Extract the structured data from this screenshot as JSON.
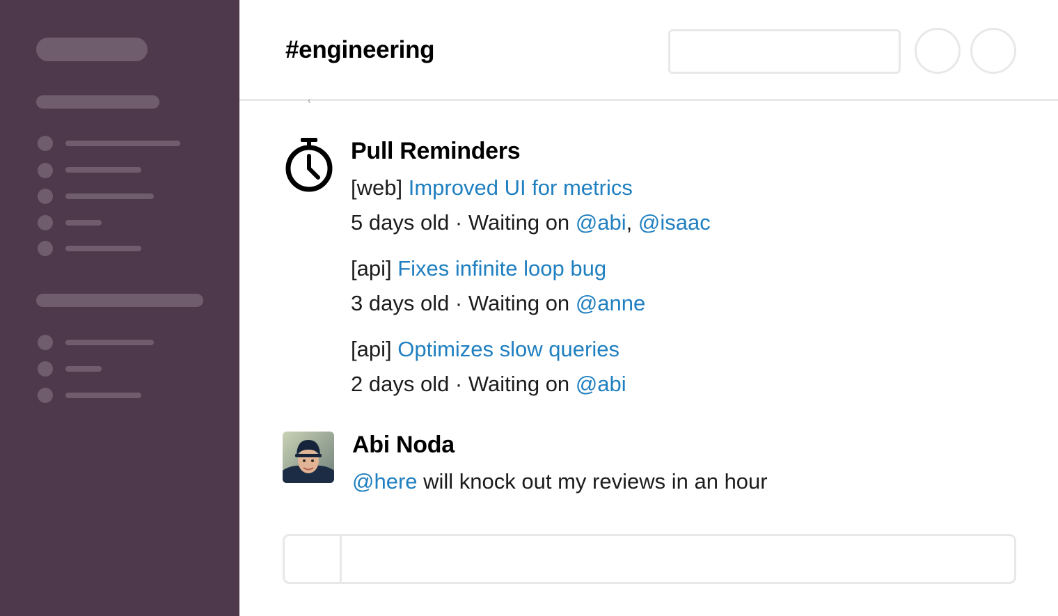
{
  "channel": {
    "name": "#engineering"
  },
  "header": {
    "search_placeholder": ""
  },
  "messages": [
    {
      "sender": "Pull Reminders",
      "icon": "stopwatch-icon",
      "reminders": [
        {
          "repo": "[web]",
          "title": "Improved UI for metrics",
          "age": "5 days old · Waiting on",
          "reviewers": [
            "@abi",
            "@isaac"
          ],
          "separator": ","
        },
        {
          "repo": "[api]",
          "title": "Fixes infinite loop bug",
          "age": "3 days old · Waiting on",
          "reviewers": [
            "@anne"
          ]
        },
        {
          "repo": "[api]",
          "title": "Optimizes slow queries",
          "age": "2 days old · Waiting on",
          "reviewers": [
            "@abi"
          ]
        }
      ]
    },
    {
      "sender": "Abi Noda",
      "mention": "@here",
      "text": "will knock out my reviews in an hour"
    }
  ],
  "stray_mark": "‹",
  "colors": {
    "sidebar_bg": "#4d394b",
    "sidebar_placeholder": "#6f5d6d",
    "link": "#1f7fc0",
    "border": "#e8e8e8"
  }
}
